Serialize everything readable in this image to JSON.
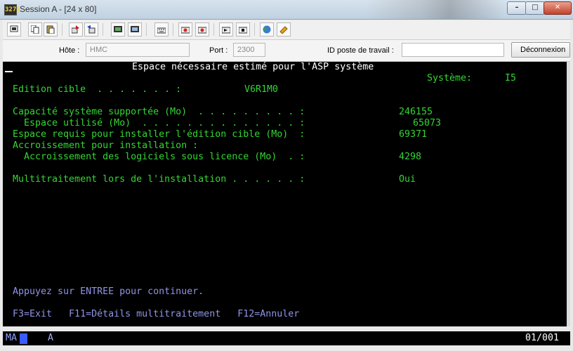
{
  "window": {
    "title": "Session A - [24 x 80]",
    "app_icon": "3270",
    "buttons": {
      "minimize": "–",
      "maximize": "□",
      "close": "✕"
    }
  },
  "toolbar": {
    "icons": [
      "copy-screen-icon",
      "copy-icon",
      "paste-icon",
      "send-icon",
      "receive-icon",
      "display-icon",
      "print-screen-icon",
      "keyboard-icon",
      "record-macro-icon",
      "play-macro-icon",
      "stop-macro-icon",
      "run-macro-icon",
      "globe-icon",
      "help-icon"
    ]
  },
  "connection": {
    "host_label": "Hôte :",
    "host_value": "HMC",
    "port_label": "Port :",
    "port_value": "2300",
    "workstation_label": "ID poste de travail :",
    "workstation_value": "",
    "disconnect_label": "Déconnexion"
  },
  "screen": {
    "title": "Espace nécessaire estimé pour l'ASP système",
    "system_label": "Système:",
    "system_value": "I5",
    "rows": [
      {
        "label": "Edition cible  . . . . . . . :",
        "value": "V6R1M0"
      },
      {
        "label": "Capacité système supportée (Mo)  . . . . . . . . . :",
        "value": "246155"
      },
      {
        "label": "  Espace utilisé (Mo)  . . . . . . . . . . . . . . :",
        "value": "65073"
      },
      {
        "label": "Espace requis pour installer l'édition cible (Mo)  :",
        "value": "69371"
      },
      {
        "label": "Accroissement pour installation :",
        "value": ""
      },
      {
        "label": "  Accroissement des logiciels sous licence (Mo)  . :",
        "value": "4298"
      },
      {
        "label": "Multitraitement lors de l'installation . . . . . . :",
        "value": "Oui"
      }
    ],
    "instruction": "Appuyez sur ENTREE pour continuer.",
    "function_keys": "F3=Exit   F11=Détails multitraitement   F12=Annuler"
  },
  "status": {
    "indicator": "MA",
    "mode": "A",
    "cursor_position": "01/001"
  },
  "colors": {
    "field_green": "#33d633",
    "info_blue": "#8f94e6",
    "title_white": "#ffffff",
    "background": "#000000"
  }
}
